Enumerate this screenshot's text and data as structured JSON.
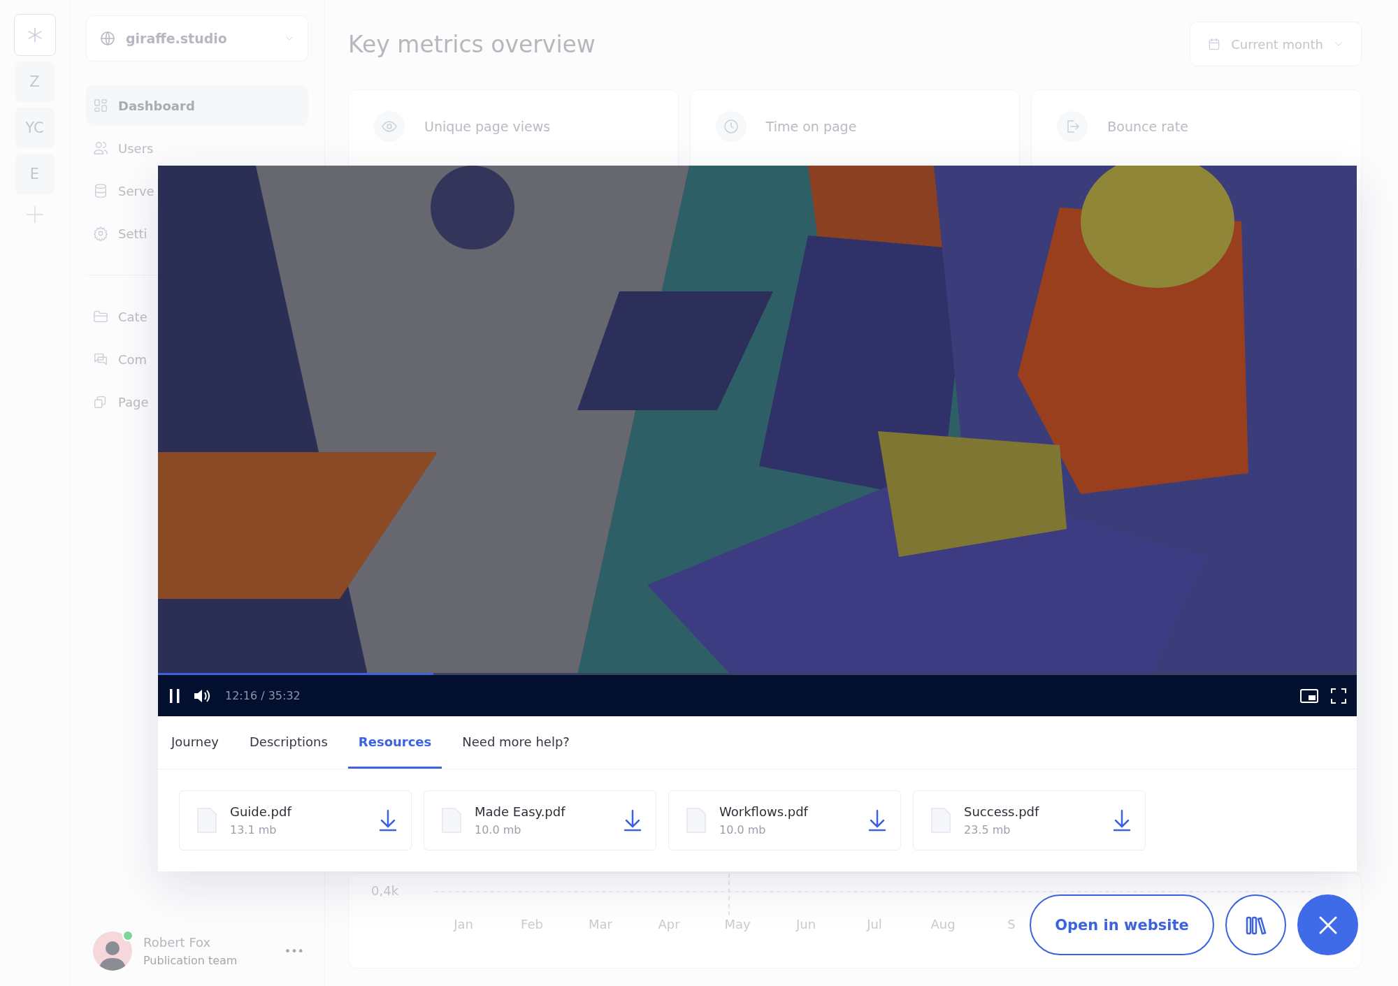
{
  "rail": {
    "items": [
      {
        "label": "Z"
      },
      {
        "label": "YC"
      },
      {
        "label": "E"
      }
    ]
  },
  "sidebar": {
    "workspace": "giraffe.studio",
    "items": [
      {
        "label": "Dashboard",
        "selected": true
      },
      {
        "label": "Users",
        "selected": false
      },
      {
        "label": "Serve",
        "selected": false
      },
      {
        "label": "Setti",
        "selected": false
      }
    ],
    "items_2": [
      {
        "label": "Cate",
        "selected": false
      },
      {
        "label": "Com",
        "selected": false
      },
      {
        "label": "Page",
        "selected": false
      }
    ],
    "user": {
      "name": "Robert Fox",
      "team": "Publication team",
      "online": true,
      "more": "•••"
    }
  },
  "header": {
    "title": "Key metrics overview",
    "period": "Current month"
  },
  "metrics": [
    {
      "label": "Unique page views"
    },
    {
      "label": "Time on page"
    },
    {
      "label": "Bounce rate"
    }
  ],
  "chart": {
    "tick": "0,4k",
    "months": [
      "Jan",
      "Feb",
      "Mar",
      "Apr",
      "May",
      "Jun",
      "Jul",
      "Aug",
      "S"
    ]
  },
  "player": {
    "playing": true,
    "time": "12:16 / 35:32",
    "progress": {
      "level": 0.23
    },
    "tabs": [
      {
        "label": "Journey",
        "selected": false
      },
      {
        "label": "Descriptions",
        "selected": false
      },
      {
        "label": "Resources",
        "selected": true
      },
      {
        "label": "Need more help?",
        "selected": false
      }
    ],
    "files": [
      {
        "name": "Guide.pdf",
        "size": "13.1 mb"
      },
      {
        "name": "Made Easy.pdf",
        "size": "10.0 mb"
      },
      {
        "name": "Workflows.pdf",
        "size": "10.0 mb"
      },
      {
        "name": "Success.pdf",
        "size": "23.5 mb"
      }
    ]
  },
  "actions": {
    "open": "Open in website"
  }
}
